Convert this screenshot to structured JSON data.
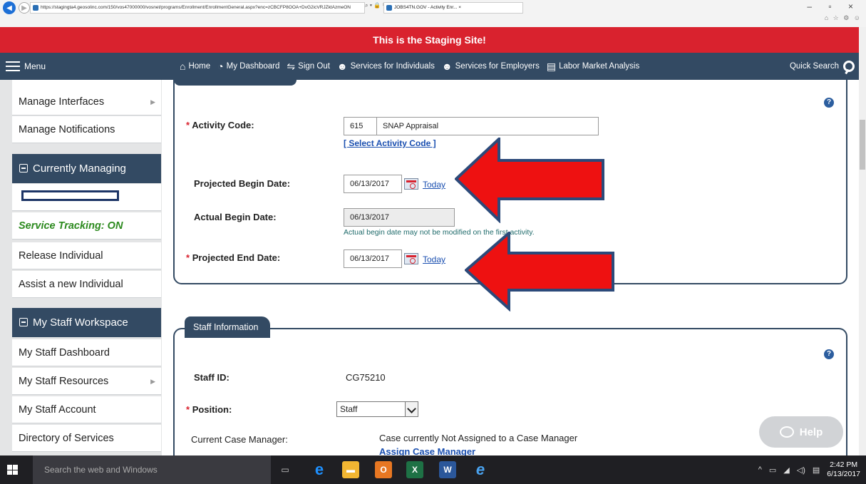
{
  "browser": {
    "url": "https://stagingta4.geosolinc.com/150/vos47000000/vosnet/programs/Enrollment/EnrollmentGeneral.aspx?enc=zCBCFP8OOA+DvG2icVRJZktAzmeON",
    "tab_title": "JOBS4TN.GOV - Activity Enr... ×",
    "window_controls": "–  ▫  ×"
  },
  "banner": {
    "text": "This is the Staging Site!"
  },
  "topnav": {
    "menu_label": "Menu",
    "links": [
      {
        "label": "Home",
        "icon": "home-icon"
      },
      {
        "label": "My Dashboard",
        "icon": "dashboard-icon"
      },
      {
        "label": "Sign Out",
        "icon": "signout-icon"
      },
      {
        "label": "Services for Individuals",
        "icon": "person-icon"
      },
      {
        "label": "Services for Employers",
        "icon": "group-icon"
      },
      {
        "label": "Labor Market Analysis",
        "icon": "chart-icon"
      }
    ],
    "quick_search": "Quick Search"
  },
  "sidebar": {
    "manage_interfaces": "Manage Interfaces",
    "manage_notifications": "Manage Notifications",
    "currently_managing": "Currently Managing",
    "service_tracking": "Service Tracking: ON",
    "release_individual": "Release Individual",
    "assist_new": "Assist a new Individual",
    "my_staff_workspace": "My Staff Workspace",
    "my_staff_dashboard": "My Staff Dashboard",
    "my_staff_resources": "My Staff Resources",
    "my_staff_account": "My Staff Account",
    "directory_of_services": "Directory of Services"
  },
  "activity": {
    "activity_code_label": "Activity Code:",
    "activity_code_value": "615",
    "activity_code_desc": "SNAP Appraisal",
    "select_activity_code": "[ Select Activity Code ]",
    "projected_begin_label": "Projected Begin Date:",
    "projected_begin_value": "06/13/2017",
    "actual_begin_label": "Actual Begin Date:",
    "actual_begin_value": "06/13/2017",
    "actual_begin_note": "Actual begin date may not be modified on the first activity.",
    "projected_end_label": "Projected End Date:",
    "projected_end_value": "06/13/2017",
    "today_label": "Today",
    "required_mark": "*"
  },
  "staff": {
    "tab_title": "Staff Information",
    "staff_id_label": "Staff ID:",
    "staff_id_value": "CG75210",
    "position_label": "Position:",
    "position_value": "Staff",
    "case_manager_label": "Current Case Manager:",
    "case_manager_value": "Case currently Not Assigned to a Case Manager",
    "assign_case_manager": "Assign Case Manager"
  },
  "help_button": "Help",
  "taskbar": {
    "search_placeholder": "Search the web and Windows",
    "time": "2:42 PM",
    "date": "6/13/2017"
  },
  "colors": {
    "banner_red": "#d9222e",
    "nav_navy": "#334a63",
    "arrow_red": "#ee1111",
    "arrow_outline": "#2c4a7a",
    "service_tracking_green": "#2c8a1e"
  }
}
